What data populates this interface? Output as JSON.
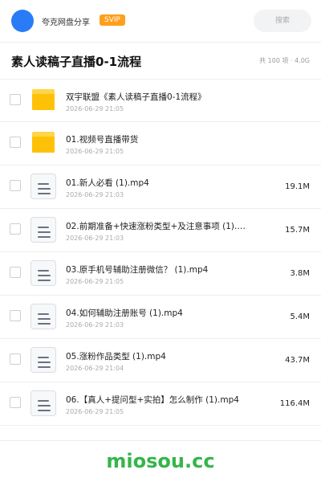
{
  "header": {
    "user_name": "夸克网盘分享",
    "badge": "SVIP",
    "search_placeholder": "搜索",
    "avatar_color": "#2a7cf6",
    "badge_color": "#ff9f1c"
  },
  "folder": {
    "title": "素人读稿子直播0-1流程",
    "meta": "共 100 项 · 4.0G"
  },
  "files": [
    {
      "type": "folder-icon",
      "name": "双宇联盟《素人读稿子直播0-1流程》",
      "date": "2026-06-29 21:05",
      "size": ""
    },
    {
      "type": "folder-icon",
      "name": "01.视频号直播带货",
      "date": "2026-06-29 21:05",
      "size": ""
    },
    {
      "type": "document-icon",
      "name": "01.新人必看 (1).mp4",
      "date": "2026-06-29 21:03",
      "size": "19.1M"
    },
    {
      "type": "document-icon",
      "name": "02.前期准备+快速涨粉类型+及注意事项 (1).…",
      "date": "2026-06-29 21:03",
      "size": "15.7M"
    },
    {
      "type": "document-icon",
      "name": "03.原手机号辅助注册微信？ (1).mp4",
      "date": "2026-06-29 21:05",
      "size": "3.8M"
    },
    {
      "type": "document-icon",
      "name": "04.如何辅助注册账号 (1).mp4",
      "date": "2026-06-29 21:03",
      "size": "5.4M"
    },
    {
      "type": "document-icon",
      "name": "05.涨粉作品类型 (1).mp4",
      "date": "2026-06-29 21:04",
      "size": "43.7M"
    },
    {
      "type": "document-icon",
      "name": "06.【真人+提问型+实拍】怎么制作 (1).mp4",
      "date": "2026-06-29 21:05",
      "size": "116.4M"
    }
  ],
  "watermark": "miosou.cc"
}
